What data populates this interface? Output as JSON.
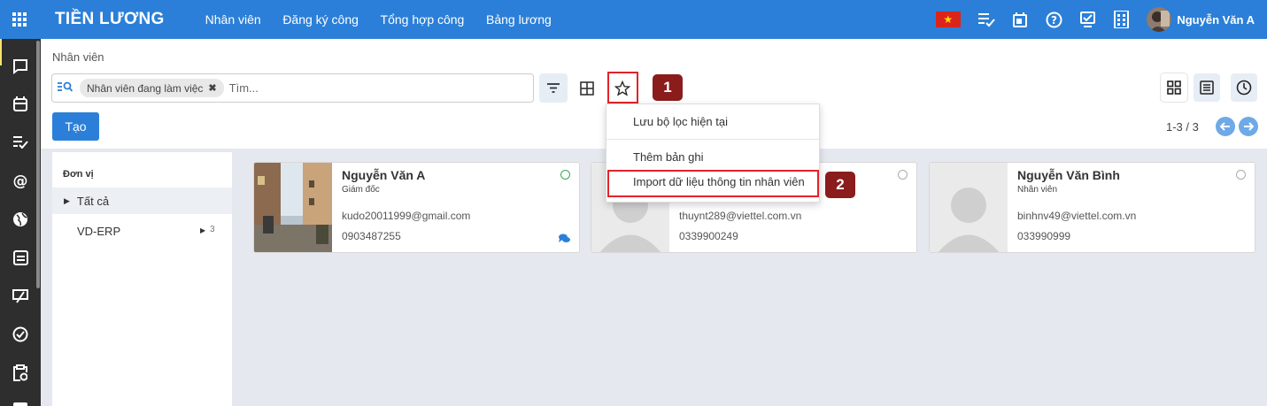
{
  "app": {
    "title": "TIỀN LƯƠNG",
    "nav": [
      "Nhân viên",
      "Đăng ký công",
      "Tổng hợp công",
      "Bảng lương"
    ],
    "user_name": "Nguyễn Văn A",
    "accent": "#2b7fd8",
    "sidebar_bg": "#2e2e2e"
  },
  "page": {
    "breadcrumb": "Nhân viên",
    "create_label": "Tạo",
    "pager": "1-3 / 3"
  },
  "search": {
    "facet": "Nhân viên đang làm việc",
    "placeholder": "Tìm..."
  },
  "markers": [
    "1",
    "2"
  ],
  "favorites_menu": {
    "items": [
      "Lưu bộ lọc hiện tại",
      "Thêm bản ghi",
      "Import dữ liệu thông tin nhân viên"
    ]
  },
  "department_panel": {
    "title": "Đơn vị",
    "all_label": "Tất cả",
    "items": [
      {
        "label": "VD-ERP",
        "count": "3"
      }
    ]
  },
  "employees": [
    {
      "name": "Nguyễn Văn A",
      "job": "Giám đốc",
      "email": "kudo20011999@gmail.com",
      "phone": "0903487255",
      "status": "online",
      "has_photo": true
    },
    {
      "name": "",
      "job": "",
      "email": "thuynt289@viettel.com.vn",
      "phone": "0339900249",
      "status": "offline",
      "has_photo": false
    },
    {
      "name": "Nguyễn Văn Bình",
      "job": "Nhân viên",
      "email": "binhnv49@viettel.com.vn",
      "phone": "033990999",
      "status": "offline",
      "has_photo": false
    }
  ],
  "icons": [
    "apps-grid-icon",
    "activity-icon",
    "calendar-icon",
    "help-icon",
    "discuss-icon",
    "company-icon",
    "filter-icon",
    "group-by-icon",
    "favorite-star-icon",
    "kanban-view-icon",
    "list-view-icon",
    "activity-view-icon",
    "prev-icon",
    "next-icon",
    "chat-icon"
  ]
}
